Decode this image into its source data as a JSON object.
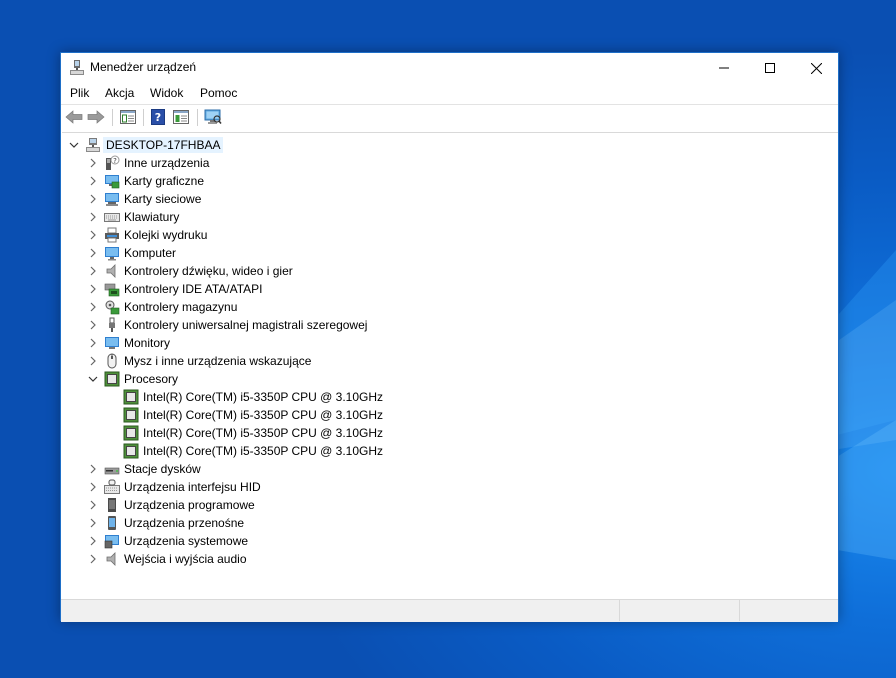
{
  "window": {
    "title": "Menedżer urządzeń"
  },
  "menu": [
    "Plik",
    "Akcja",
    "Widok",
    "Pomoc"
  ],
  "toolbar": {
    "buttons": [
      "back-icon",
      "forward-icon",
      "properties-icon",
      "help-icon",
      "update-driver-icon",
      "scan-hardware-icon"
    ]
  },
  "tree": {
    "root": {
      "label": "DESKTOP-17FHBAA",
      "icon": "computer-network-icon"
    },
    "categories": [
      {
        "label": "Inne urządzenia",
        "icon": "unknown-device-icon"
      },
      {
        "label": "Karty graficzne",
        "icon": "display-adapter-icon"
      },
      {
        "label": "Karty sieciowe",
        "icon": "network-adapter-icon"
      },
      {
        "label": "Klawiatury",
        "icon": "keyboard-icon"
      },
      {
        "label": "Kolejki wydruku",
        "icon": "printer-icon"
      },
      {
        "label": "Komputer",
        "icon": "computer-icon"
      },
      {
        "label": "Kontrolery dźwięku, wideo i gier",
        "icon": "speaker-icon"
      },
      {
        "label": "Kontrolery IDE ATA/ATAPI",
        "icon": "ide-controller-icon"
      },
      {
        "label": "Kontrolery magazynu",
        "icon": "storage-controller-icon"
      },
      {
        "label": "Kontrolery uniwersalnej magistrali szeregowej",
        "icon": "usb-icon"
      },
      {
        "label": "Monitory",
        "icon": "monitor-icon"
      },
      {
        "label": "Mysz i inne urządzenia wskazujące",
        "icon": "mouse-icon"
      },
      {
        "label": "Procesory",
        "icon": "processor-icon",
        "expanded": true,
        "children": [
          "Intel(R) Core(TM) i5-3350P CPU @ 3.10GHz",
          "Intel(R) Core(TM) i5-3350P CPU @ 3.10GHz",
          "Intel(R) Core(TM) i5-3350P CPU @ 3.10GHz",
          "Intel(R) Core(TM) i5-3350P CPU @ 3.10GHz"
        ]
      },
      {
        "label": "Stacje dysków",
        "icon": "disk-drive-icon"
      },
      {
        "label": "Urządzenia interfejsu HID",
        "icon": "hid-icon"
      },
      {
        "label": "Urządzenia programowe",
        "icon": "software-device-icon"
      },
      {
        "label": "Urządzenia przenośne",
        "icon": "portable-device-icon"
      },
      {
        "label": "Urządzenia systemowe",
        "icon": "system-device-icon"
      },
      {
        "label": "Wejścia i wyjścia audio",
        "icon": "audio-io-icon"
      }
    ]
  },
  "colors": {
    "desktop": "#0a5bc4",
    "selection": "#e5f3ff",
    "window_border": "#1e6fc8"
  }
}
